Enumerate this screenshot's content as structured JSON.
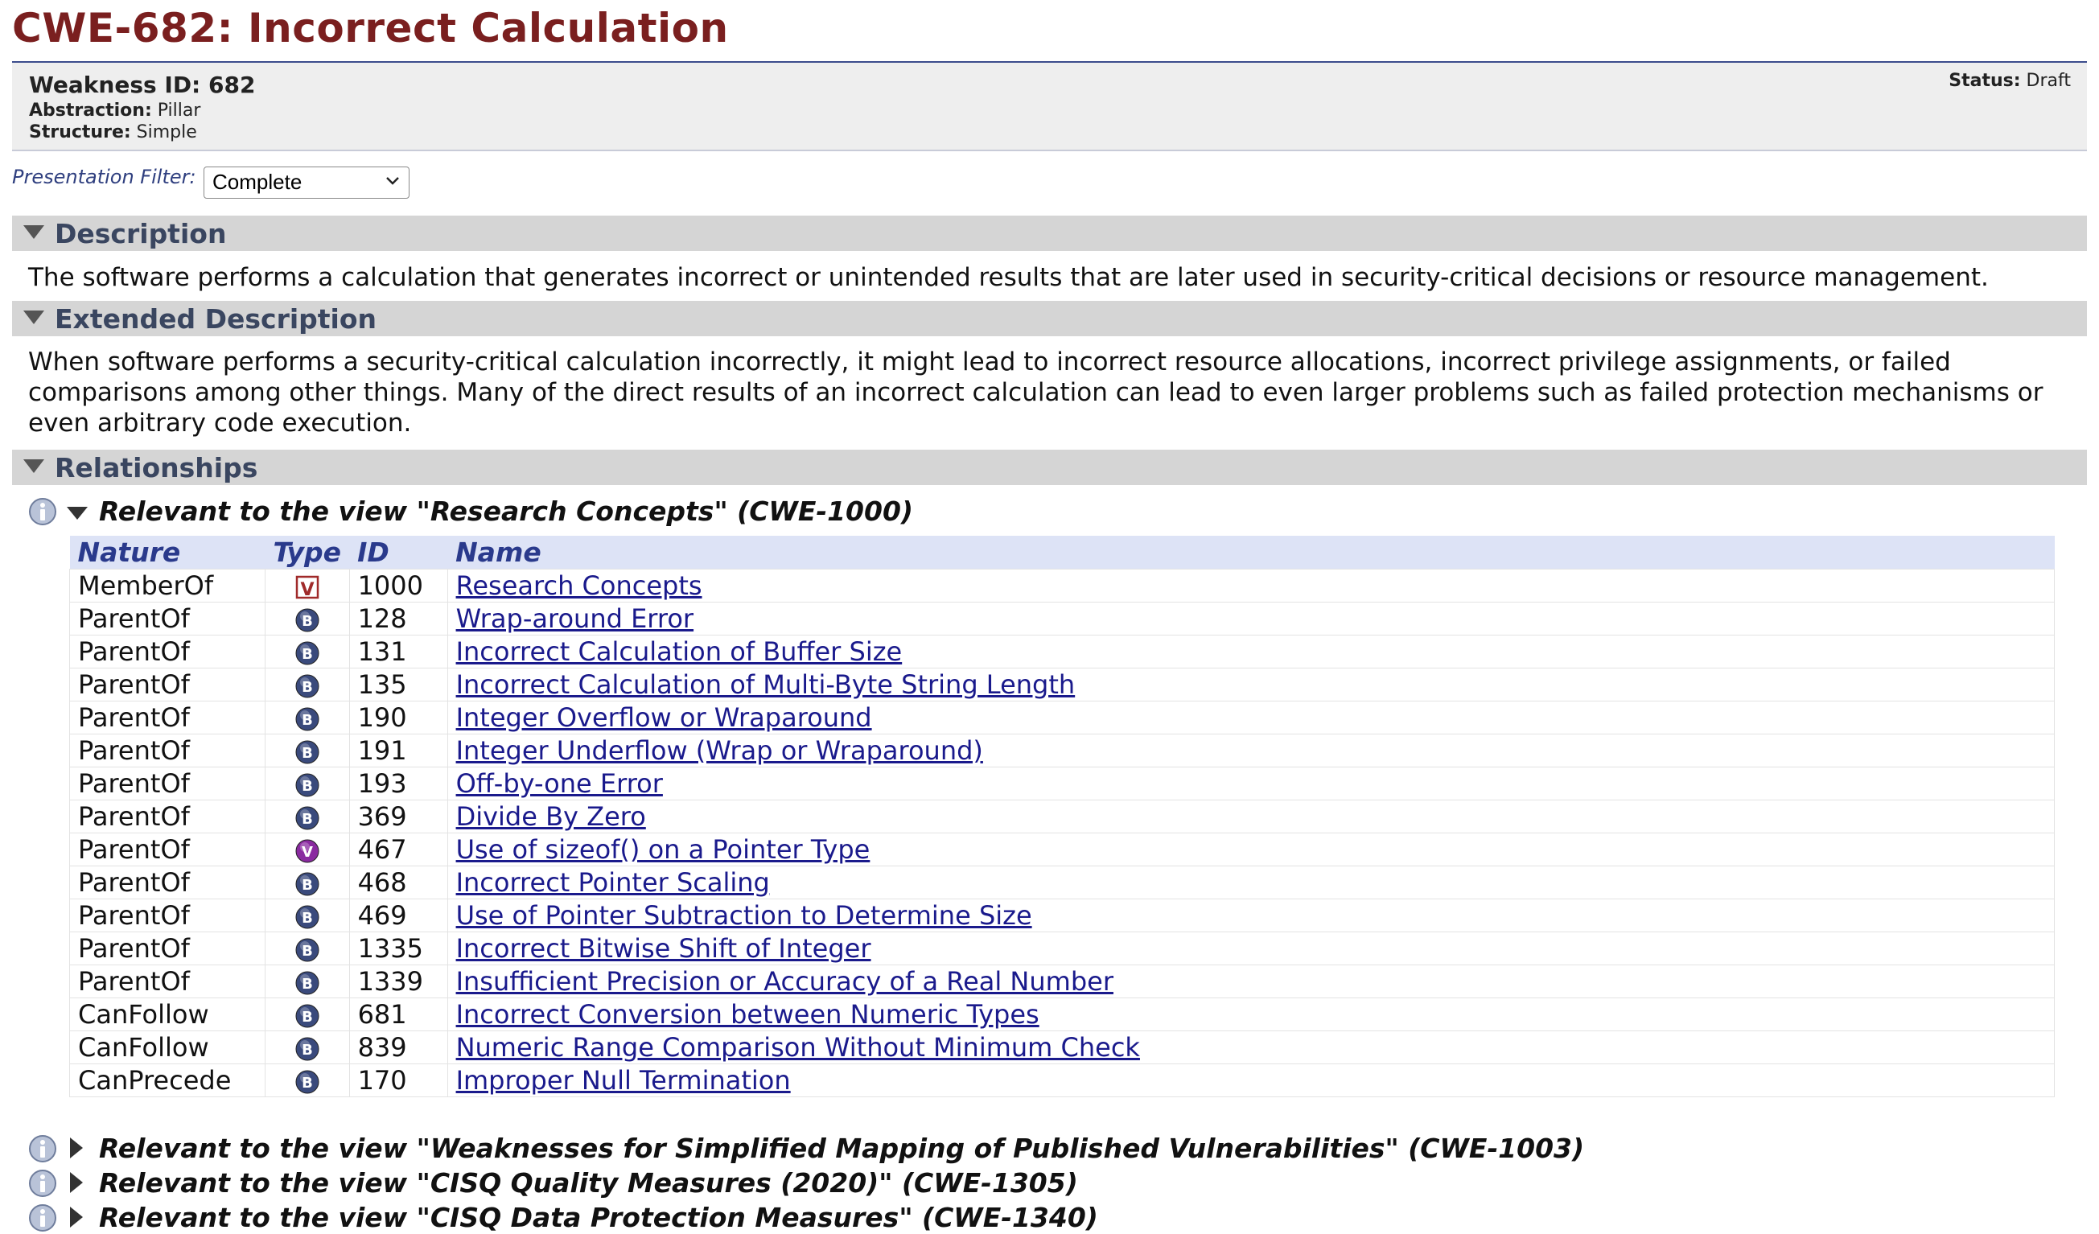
{
  "page_title": "CWE-682: Incorrect Calculation",
  "meta": {
    "weakness_id_label": "Weakness ID: 682",
    "abstraction_label": "Abstraction:",
    "abstraction_value": "Pillar",
    "structure_label": "Structure:",
    "structure_value": "Simple",
    "status_label": "Status:",
    "status_value": "Draft"
  },
  "filter": {
    "label": "Presentation Filter:",
    "selected": "Complete"
  },
  "sections": {
    "description": {
      "title": "Description",
      "text": "The software performs a calculation that generates incorrect or unintended results that are later used in security-critical decisions or resource management."
    },
    "extended": {
      "title": "Extended Description",
      "text": "When software performs a security-critical calculation incorrectly, it might lead to incorrect resource allocations, incorrect privilege assignments, or failed comparisons among other things. Many of the direct results of an incorrect calculation can lead to even larger problems such as failed protection mechanisms or even arbitrary code execution."
    },
    "relationships": {
      "title": "Relationships"
    }
  },
  "views": [
    {
      "label": "Relevant to the view \"Research Concepts\" (CWE-1000)",
      "expanded": true
    },
    {
      "label": "Relevant to the view \"Weaknesses for Simplified Mapping of Published Vulnerabilities\" (CWE-1003)",
      "expanded": false
    },
    {
      "label": "Relevant to the view \"CISQ Quality Measures (2020)\" (CWE-1305)",
      "expanded": false
    },
    {
      "label": "Relevant to the view \"CISQ Data Protection Measures\" (CWE-1340)",
      "expanded": false
    }
  ],
  "table": {
    "headers": {
      "nature": "Nature",
      "type": "Type",
      "id": "ID",
      "name": "Name"
    },
    "rows": [
      {
        "nature": "MemberOf",
        "type": "view-icon",
        "id": "1000",
        "name": "Research Concepts"
      },
      {
        "nature": "ParentOf",
        "type": "base-icon",
        "id": "128",
        "name": "Wrap-around Error"
      },
      {
        "nature": "ParentOf",
        "type": "base-icon",
        "id": "131",
        "name": "Incorrect Calculation of Buffer Size"
      },
      {
        "nature": "ParentOf",
        "type": "base-icon",
        "id": "135",
        "name": "Incorrect Calculation of Multi-Byte String Length"
      },
      {
        "nature": "ParentOf",
        "type": "base-icon",
        "id": "190",
        "name": "Integer Overflow or Wraparound"
      },
      {
        "nature": "ParentOf",
        "type": "base-icon",
        "id": "191",
        "name": "Integer Underflow (Wrap or Wraparound)"
      },
      {
        "nature": "ParentOf",
        "type": "base-icon",
        "id": "193",
        "name": "Off-by-one Error"
      },
      {
        "nature": "ParentOf",
        "type": "base-icon",
        "id": "369",
        "name": "Divide By Zero"
      },
      {
        "nature": "ParentOf",
        "type": "variant-icon",
        "id": "467",
        "name": "Use of sizeof() on a Pointer Type"
      },
      {
        "nature": "ParentOf",
        "type": "base-icon",
        "id": "468",
        "name": "Incorrect Pointer Scaling"
      },
      {
        "nature": "ParentOf",
        "type": "base-icon",
        "id": "469",
        "name": "Use of Pointer Subtraction to Determine Size"
      },
      {
        "nature": "ParentOf",
        "type": "base-icon",
        "id": "1335",
        "name": "Incorrect Bitwise Shift of Integer"
      },
      {
        "nature": "ParentOf",
        "type": "base-icon",
        "id": "1339",
        "name": "Insufficient Precision or Accuracy of a Real Number"
      },
      {
        "nature": "CanFollow",
        "type": "base-icon",
        "id": "681",
        "name": "Incorrect Conversion between Numeric Types"
      },
      {
        "nature": "CanFollow",
        "type": "base-icon",
        "id": "839",
        "name": "Numeric Range Comparison Without Minimum Check"
      },
      {
        "nature": "CanPrecede",
        "type": "base-icon",
        "id": "170",
        "name": "Improper Null Termination"
      }
    ]
  },
  "colors": {
    "title": "#7a1f1f",
    "header_text": "#2a3a8c",
    "link": "#1a1a8c",
    "section_bar": "#d5d5d5",
    "variant_icon": "#8a2aa0",
    "base_icon": "#3a4a7c",
    "view_icon": "#a02a2a"
  }
}
